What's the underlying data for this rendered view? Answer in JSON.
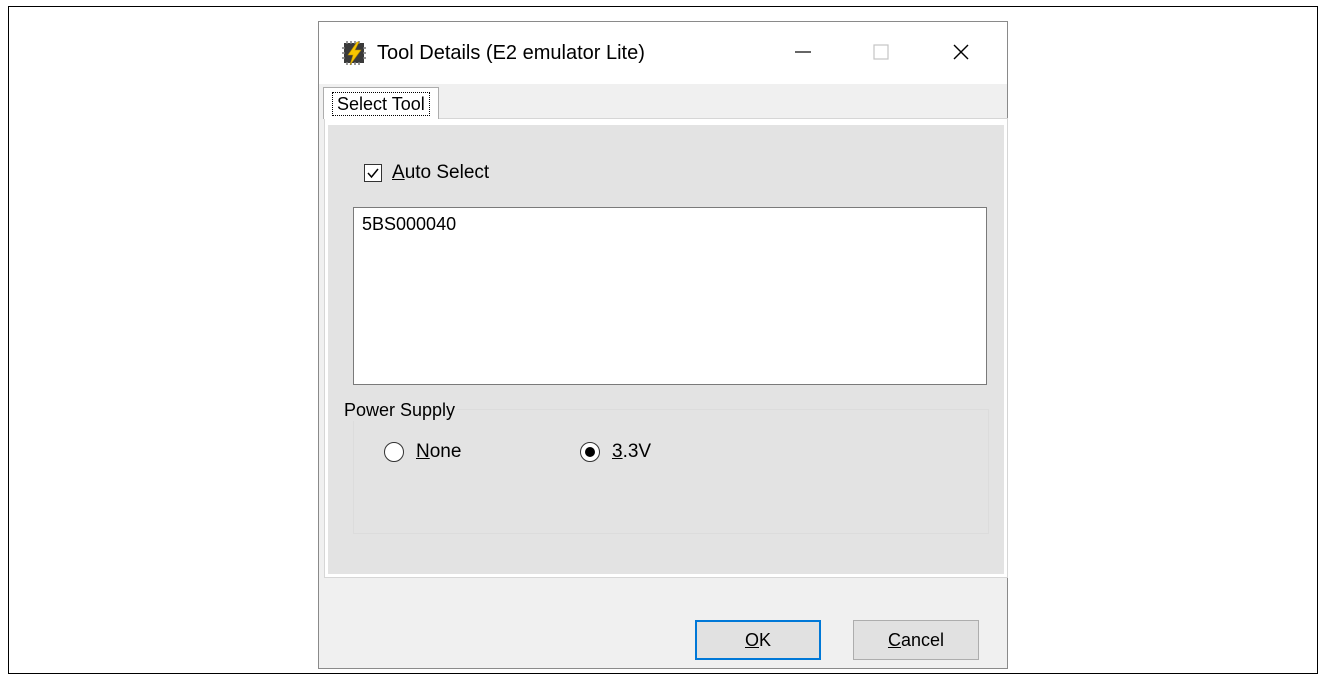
{
  "window": {
    "title": "Tool Details (E2 emulator Lite)",
    "icon": "lightning-chip-icon"
  },
  "tabs": [
    {
      "label": "Select Tool",
      "selected": true
    }
  ],
  "auto_select": {
    "label_first": "A",
    "label_rest": "uto Select",
    "checked": true
  },
  "tool_list": {
    "items": [
      "5BS000040"
    ]
  },
  "power_supply": {
    "label": "Power Supply",
    "options": [
      {
        "mnemonic": "N",
        "rest": "one",
        "selected": false
      },
      {
        "mnemonic": "3",
        "rest": ".3V",
        "selected": true
      }
    ]
  },
  "buttons": {
    "ok_mnemonic": "O",
    "ok_rest": "K",
    "cancel_mnemonic": "C",
    "cancel_rest": "ancel"
  },
  "colors": {
    "focus_border": "#0078d7",
    "dialog_bg": "#f0f0f0"
  }
}
